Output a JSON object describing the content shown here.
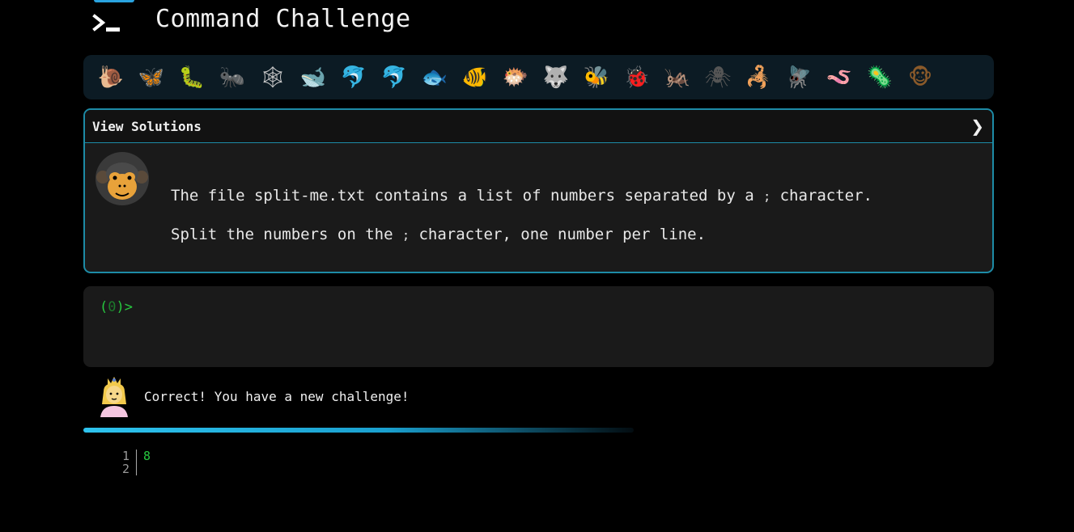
{
  "header": {
    "title": "Command Challenge",
    "logo_icon": "terminal-prompt-icon"
  },
  "animal_strip": [
    {
      "name": "snail",
      "glyph": "🐌",
      "color": "#8a6a4a"
    },
    {
      "name": "butterfly",
      "glyph": "🦋",
      "color": "#e08a3a"
    },
    {
      "name": "caterpillar",
      "glyph": "🐛",
      "color": "#6bb33a"
    },
    {
      "name": "ant",
      "glyph": "🐜",
      "color": "#5a3a2a"
    },
    {
      "name": "spider-web",
      "glyph": "🕸",
      "color": "#c8c8c8"
    },
    {
      "name": "whale",
      "glyph": "🐋",
      "color": "#4fa0d6"
    },
    {
      "name": "dolphin",
      "glyph": "🐬",
      "color": "#4fa0d6"
    },
    {
      "name": "dolphin-gray",
      "glyph": "🐬",
      "color": "#9aa3aa"
    },
    {
      "name": "fish",
      "glyph": "🐟",
      "color": "#4fa0d6"
    },
    {
      "name": "tropical-fish",
      "glyph": "🐠",
      "color": "#f0c020"
    },
    {
      "name": "blowfish",
      "glyph": "🐡",
      "color": "#8a6a4a"
    },
    {
      "name": "wolf",
      "glyph": "🐺",
      "color": "#8a8f96"
    },
    {
      "name": "bee",
      "glyph": "🐝",
      "color": "#f0d040"
    },
    {
      "name": "ladybug",
      "glyph": "🐞",
      "color": "#d62d2d"
    },
    {
      "name": "cricket",
      "glyph": "🦗",
      "color": "#6bb33a"
    },
    {
      "name": "spider",
      "glyph": "🕷",
      "color": "#555"
    },
    {
      "name": "scorpion",
      "glyph": "🦂",
      "color": "#c0392b"
    },
    {
      "name": "fly",
      "glyph": "🪰",
      "color": "#9aa3aa"
    },
    {
      "name": "worm",
      "glyph": "🪱",
      "color": "#d47a9a"
    },
    {
      "name": "microbe",
      "glyph": "🦠",
      "color": "#4fa0d6"
    },
    {
      "name": "monkey",
      "glyph": "🐵",
      "color": "#8a5a2a"
    }
  ],
  "solutions": {
    "toggle_label": "View Solutions",
    "chevron": "❯",
    "line1_pre": "The file split-me.txt contains a list of numbers separated by a ",
    "line1_code": ";",
    "line1_post": " character.",
    "line2_pre": "Split the numbers on the ",
    "line2_code": ";",
    "line2_post": " character, one number per line."
  },
  "terminal": {
    "prompt_open": "(",
    "prompt_count": "0",
    "prompt_close": ")>"
  },
  "feedback": {
    "message": "Correct! You have a new challenge!"
  },
  "progress": {
    "fraction": 0.6
  },
  "editor": {
    "line_numbers": [
      "1",
      "2"
    ],
    "lines": [
      "8",
      ""
    ]
  },
  "colors": {
    "accent": "#1d8ba6",
    "prompt_green": "#27c93f",
    "progress": "#2ec3ee"
  }
}
